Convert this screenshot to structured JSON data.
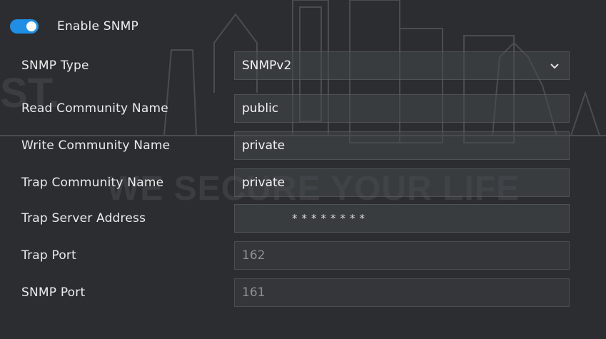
{
  "snmp": {
    "enable_label": "Enable SNMP",
    "enabled": true,
    "fields": [
      {
        "label": "SNMP Type",
        "value": "SNMPv2",
        "kind": "select"
      },
      {
        "label": "Read Community Name",
        "value": "public",
        "kind": "text"
      },
      {
        "label": "Write Community Name",
        "value": "private",
        "kind": "text"
      },
      {
        "label": "Trap Community Name",
        "value": "private",
        "kind": "text"
      },
      {
        "label": "Trap Server Address",
        "value": "********",
        "kind": "masked"
      },
      {
        "label": "Trap Port",
        "value": "162",
        "kind": "disabled"
      },
      {
        "label": "SNMP Port",
        "value": "161",
        "kind": "disabled"
      }
    ]
  },
  "colors": {
    "toggle_on": "#1f8fe6",
    "background": "#2b2d30"
  },
  "icons": {
    "select_arrow": "chevron-down-icon"
  }
}
